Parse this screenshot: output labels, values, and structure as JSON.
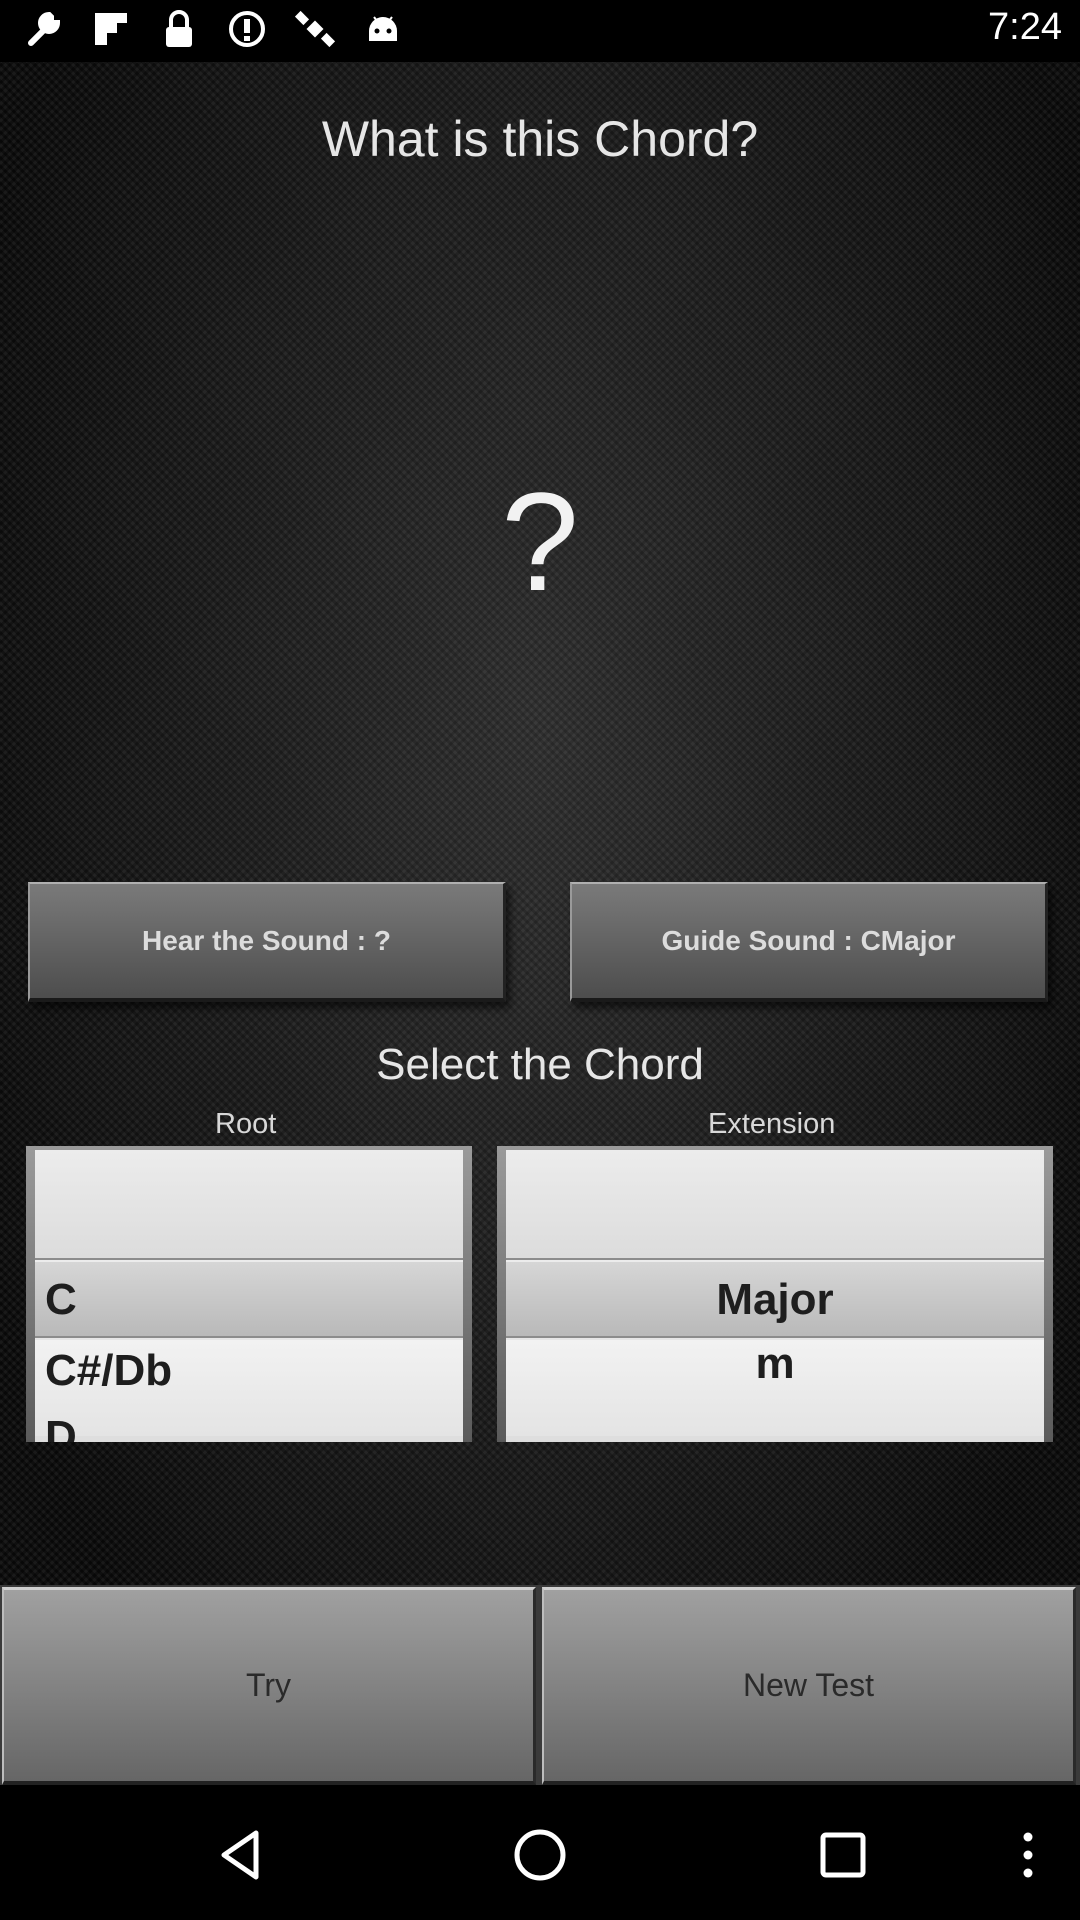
{
  "status_bar": {
    "time": "7:24",
    "icons": [
      "wrench-icon",
      "flipboard-icon",
      "lock-icon",
      "info-icon",
      "satellite-icon",
      "android-icon"
    ]
  },
  "quiz": {
    "title": "What is this Chord?",
    "mystery_symbol": "?"
  },
  "buttons": {
    "hear": "Hear the Sound : ?",
    "guide": "Guide Sound : CMajor"
  },
  "selector": {
    "title": "Select the Chord",
    "root_label": "Root",
    "extension_label": "Extension",
    "root_options": [
      "",
      "C",
      "C#/Db",
      "D"
    ],
    "extension_options": [
      "",
      "Major",
      "m"
    ]
  },
  "actions": {
    "try": "Try",
    "new_test": "New Test"
  },
  "nav": {
    "icons": [
      "back-icon",
      "home-icon",
      "recent-apps-icon",
      "more-icon"
    ]
  }
}
